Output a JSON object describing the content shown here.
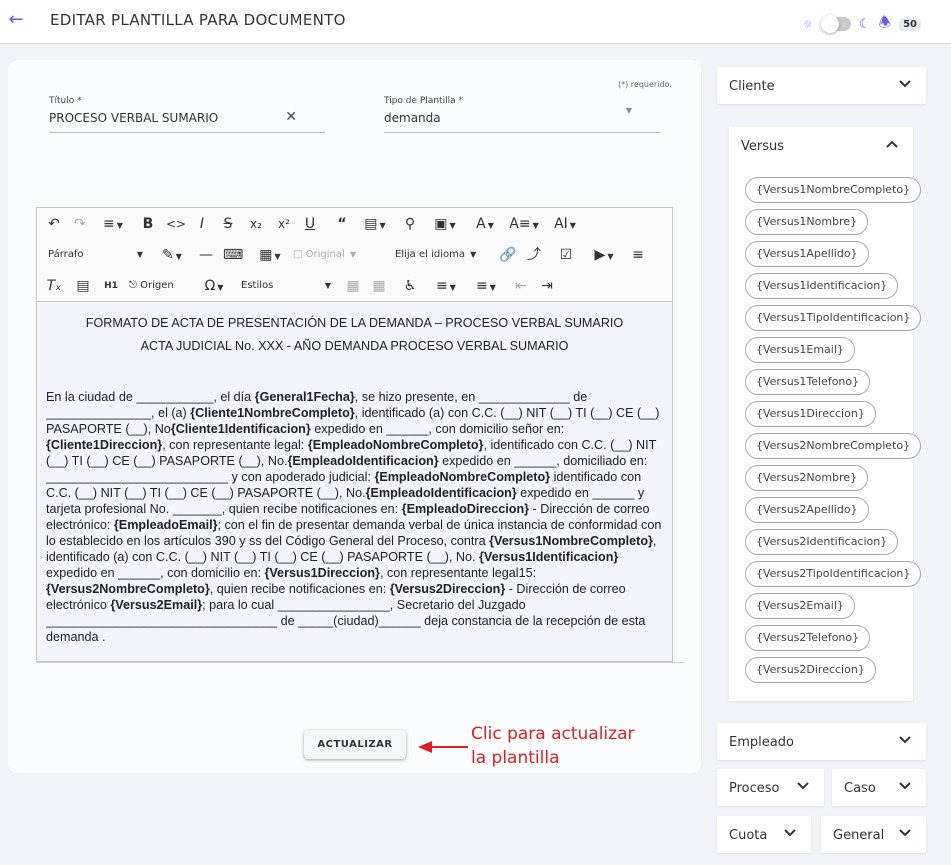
{
  "header": {
    "title": "EDITAR PLANTILLA PARA DOCUMENTO",
    "notifications_count": "50"
  },
  "form": {
    "required_note": "(*) requerido.",
    "title_label": "Título *",
    "title_value": "PROCESO VERBAL SUMARIO",
    "type_label": "Tipo de Plantilla *",
    "type_value": "demanda"
  },
  "toolbar": {
    "paragraph": "Párrafo",
    "original": "Original",
    "language": "Elija el idioma",
    "source": "Origen",
    "styles": "Estilos"
  },
  "document": {
    "heading1": "FORMATO DE ACTA DE PRESENTACIÓN DE LA DEMANDA – PROCESO VERBAL SUMARIO",
    "heading2": "ACTA JUDICIAL No. XXX - AÑO DEMANDA PROCESO VERBAL SUMARIO",
    "t01": "En la ciudad de ___________, el día ",
    "v01": "{General1Fecha}",
    "t02": ", se hizo presente, en _____________ de _______________, el (a) ",
    "v02": "{Cliente1NombreCompleto}",
    "t03": ", identificado (a) con C.C. (__) NIT (__)  TI (__)  CE (__) PASAPORTE (__), No",
    "v03": "{Cliente1Identificacion}",
    "t04": " expedido en ______, con domicilio señor en: ",
    "v04": "{Cliente1Direccion}",
    "t05": ", con representante legal: ",
    "v05": "{EmpleadoNombreCompleto}",
    "t06": ", identificado con C.C. (__) NIT (__)  TI (__)  CE (__) PASAPORTE (__), No.",
    "v06": "{EmpleadoIdentificacion}",
    "t07": " expedido en ______, domiciliado en: __________________________ y con apoderado judicial: ",
    "v07": "{EmpleadoNombreCompleto}",
    "t08": " identificado con C.C. (__) NIT (__)  TI (__)  CE (__) PASAPORTE (__), No.",
    "v08": "{EmpleadoIdentificacion}",
    "t09": " expedido en ______  y tarjeta profesional No. _______, quien recibe notificaciones en: ",
    "v09": "{EmpleadoDireccion}",
    "t10": " - Dirección de correo electrónico: ",
    "v10": "{EmpleadoEmail}",
    "t11": "; con el fin de presentar demanda verbal de única instancia de conformidad con lo establecido en los artículos 390 y ss del Código General del Proceso, contra ",
    "v11": "{Versus1NombreCompleto}",
    "t12": ", identificado (a) con C.C. (__) NIT (__)  TI (__)  CE (__) PASAPORTE (__), No. ",
    "v12": "{Versus1Identificacion}",
    "t13": " expedido en ______, con domicilio en: ",
    "v13": "{Versus1Direccion}",
    "t14": ", con representante legal15: ",
    "v14": "{Versus2NombreCompleto}",
    "t15": ", quien recibe notificaciones en: ",
    "v15": "{Versus2Direccion}",
    "t16": " - Dirección de correo electrónico ",
    "v16": "{Versus2Email}",
    "t17": "; para lo cual ________________, Secretario del Juzgado _________________________________ de _____(ciudad)______ deja constancia de la recepción de esta demanda ."
  },
  "actions": {
    "update": "ACTUALIZAR"
  },
  "annotation": {
    "line1": "Clic para actualizar",
    "line2": "la plantilla"
  },
  "sidebar": {
    "cliente": "Cliente",
    "versus": "Versus",
    "versus_chips": [
      "{Versus1NombreCompleto}",
      "{Versus1Nombre}",
      "{Versus1Apellido}",
      "{Versus1Identificacion}",
      "{Versus1TipoIdentificacion}",
      "{Versus1Email}",
      "{Versus1Telefono}",
      "{Versus1Direccion}",
      "{Versus2NombreCompleto}",
      "{Versus2Nombre}",
      "{Versus2Apellido}",
      "{Versus2Identificacion}",
      "{Versus2TipoIdentificacion}",
      "{Versus2Email}",
      "{Versus2Telefono}",
      "{Versus2Direccion}"
    ],
    "empleado": "Empleado",
    "proceso": "Proceso",
    "caso": "Caso",
    "cuota": "Cuota",
    "general": "General"
  },
  "colors": {
    "accent": "#6c5ce7",
    "annotation": "#e02020"
  }
}
